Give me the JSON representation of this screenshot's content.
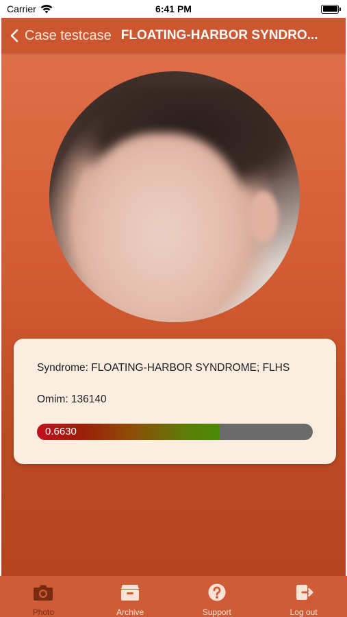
{
  "status_bar": {
    "carrier": "Carrier",
    "time": "6:41 PM"
  },
  "nav": {
    "back_label": "Case testcase",
    "title": "FLOATING-HARBOR SYNDRO..."
  },
  "card": {
    "syndrome": "Syndrome: FLOATING-HARBOR SYNDROME; FLHS",
    "omim": "Omim: 136140",
    "score_label": "0.6630",
    "score_value": 0.663
  },
  "tabs": [
    {
      "label": "Photo",
      "icon": "camera-icon",
      "active": true
    },
    {
      "label": "Archive",
      "icon": "archive-box-icon",
      "active": false
    },
    {
      "label": "Support",
      "icon": "question-circle-icon",
      "active": false
    },
    {
      "label": "Log out",
      "icon": "logout-icon",
      "active": false
    }
  ],
  "colors": {
    "accent": "#cc5630",
    "card": "#fbeee0",
    "tab_active": "#7a2c12"
  }
}
